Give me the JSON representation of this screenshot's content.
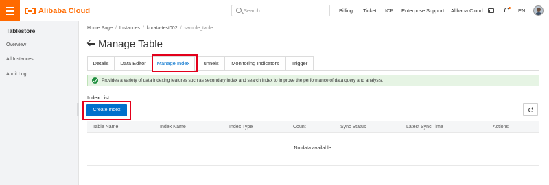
{
  "brand": {
    "name": "Alibaba Cloud",
    "accent": "#ff6a00",
    "primary": "#0070cc"
  },
  "topbar": {
    "search_placeholder": "Search",
    "links": [
      "Billing",
      "Ticket",
      "ICP",
      "Enterprise",
      "Support",
      "Alibaba Cloud"
    ],
    "language": "EN",
    "icons": [
      "menu-icon",
      "mail-icon",
      "bell-icon",
      "avatar"
    ]
  },
  "sidebar": {
    "title": "Tablestore",
    "items": [
      "Overview",
      "All Instances",
      "Audit Log"
    ]
  },
  "breadcrumb": [
    "Home Page",
    "Instances",
    "kurata-test002",
    "sample_table"
  ],
  "page": {
    "title": "Manage Table"
  },
  "tabs": [
    {
      "label": "Details",
      "active": false
    },
    {
      "label": "Data Editor",
      "active": false
    },
    {
      "label": "Manage Index",
      "active": true
    },
    {
      "label": "Tunnels",
      "active": false
    },
    {
      "label": "Monitoring Indicators",
      "active": false
    },
    {
      "label": "Trigger",
      "active": false
    }
  ],
  "notice": {
    "text": "Provides a variety of data indexing features such as secondary index and search index to improve the performance of data query and analysis.",
    "status_color": "#1e8e3e"
  },
  "index_list": {
    "label": "Index List",
    "create_button": "Create Index",
    "columns": [
      "Table Name",
      "Index Name",
      "Index Type",
      "Count",
      "Sync Status",
      "Latest Sync Time",
      "Actions"
    ],
    "rows": [],
    "empty_text": "No data available."
  },
  "highlight_color": "#e3001b"
}
